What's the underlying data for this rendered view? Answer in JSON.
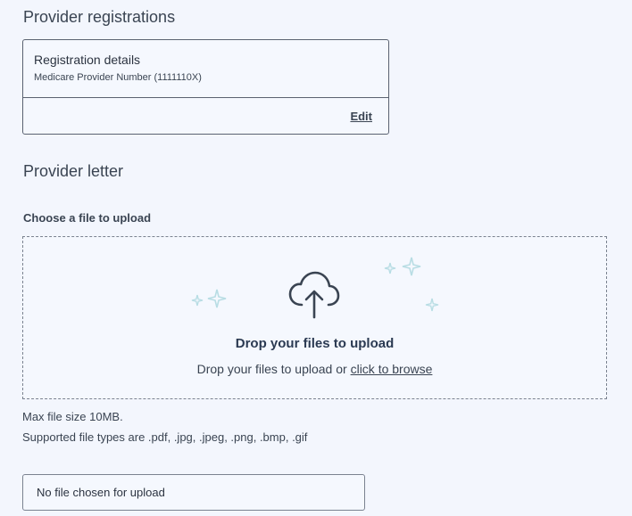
{
  "registrations": {
    "title": "Provider registrations",
    "card": {
      "heading": "Registration details",
      "subtitle": "Medicare Provider Number (1111110X)",
      "edit_label": "Edit"
    }
  },
  "letter": {
    "title": "Provider letter",
    "upload_label": "Choose a file to upload",
    "dropzone": {
      "icon": "cloud-upload-icon",
      "title": "Drop your files to upload",
      "subtitle_prefix": "Drop your files to upload or ",
      "browse_label": "click to browse"
    },
    "max_size": "Max file size 10MB.",
    "supported_types": "Supported file types are .pdf, .jpg, .jpeg, .png, .bmp, .gif",
    "file_status": "No file chosen for upload"
  },
  "colors": {
    "background": "#f3f6fd",
    "text": "#2b3340",
    "border": "#5a6270",
    "sparkle": "#b8dde4",
    "icon": "#3a4452"
  }
}
